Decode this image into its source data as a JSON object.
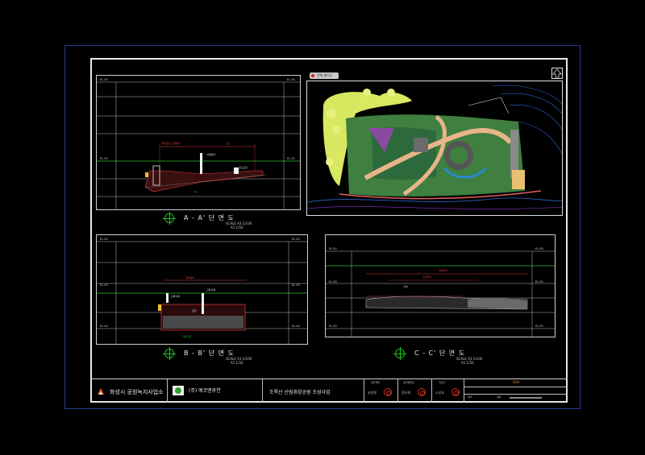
{
  "sections": {
    "aa": {
      "title": "A - A' 단 면 도",
      "scale_line1": "SCALE A3 1/100",
      "scale_line2": "A1 1/50"
    },
    "bb": {
      "title": "B - B' 단 면 도",
      "scale_line1": "SCALE A3 1/100",
      "scale_line2": "A1 1/50"
    },
    "cc": {
      "title": "C - C' 단 면 도",
      "scale_line1": "SCALE A3 1/100",
      "scale_line2": "A1 1/50"
    }
  },
  "section_levels": {
    "top": "EL.00",
    "mid": "EL.00",
    "low": "EL.00",
    "bottom": "EL.00"
  },
  "section_annotations": {
    "aa_dim_left": "계획포장 조경영역",
    "aa_dim_right": "도로",
    "aa_note_1": "식재영역",
    "aa_note_2": "보도포장",
    "aa_ground": "G.L",
    "bb_dim": "계획영역",
    "bb_note_1": "관목식재",
    "bb_note_2": "교목식재",
    "bb_note_3": "포장",
    "bb_ground": "지반조성",
    "cc_dim_1": "계획영역",
    "cc_dim_2": "조경영역",
    "cc_note": "식재"
  },
  "plan_view": {
    "tag": "전체 배치도"
  },
  "title_block": {
    "client": "화성시 공원녹지사업소",
    "designer": "(주) 에코앤후연",
    "project": "조록산 산림휴양공원 조성사업",
    "approval_1": "총괄책임",
    "approval_2": "분야별책임",
    "approval_3": "작성자",
    "name_1": "송경철",
    "name_2": "정유재",
    "name_3": "소성효",
    "drawing_no": "SOA",
    "scale_label": "축척",
    "date_label": "날짜"
  },
  "colors": {
    "frame": "#e8e8e8",
    "accent_green": "#20c020",
    "dim_red": "#e04040",
    "seal_red": "#d03020"
  }
}
